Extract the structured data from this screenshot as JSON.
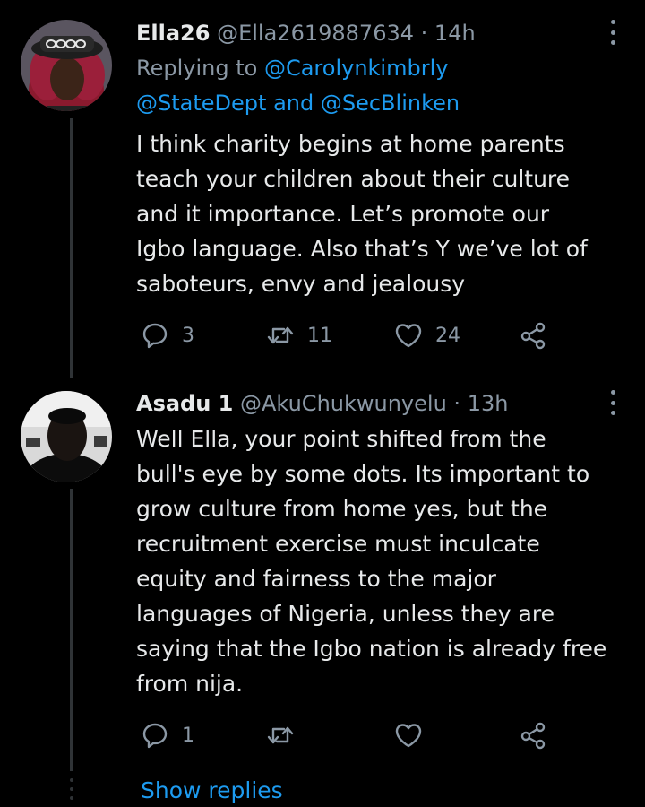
{
  "tweets": [
    {
      "name": "Ella26",
      "handle": "@Ella2619887634",
      "time": "14h",
      "replying_prefix": "Replying to",
      "mentions_line1": "@Carolynkimbrly",
      "mentions_line2_a": "@StateDept",
      "mentions_and": "and",
      "mentions_line2_b": "@SecBlinken",
      "text_lines": [
        "I think charity begins at home parents",
        "teach your children about their culture",
        "and it importance. Let’s promote our",
        "Igbo language. Also that’s Y we’ve lot of",
        "saboteurs, envy and jealousy"
      ],
      "replies": "3",
      "retweets": "11",
      "likes": "24"
    },
    {
      "name": "Asadu 1",
      "handle": "@AkuChukwunyelu",
      "time": "13h",
      "text_lines": [
        "Well Ella, your point shifted from the",
        "bull's eye by some dots. Its important to",
        "grow culture from home yes, but the",
        "recruitment exercise must inculcate",
        "equity and fairness to the major",
        "languages of Nigeria, unless they are",
        "saying that the Igbo nation is already free",
        "from nija."
      ],
      "replies": "1"
    }
  ],
  "show_replies_label": "Show replies",
  "icons": [
    "reply-icon",
    "retweet-icon",
    "like-icon",
    "share-icon",
    "more-icon"
  ],
  "colors": {
    "background": "#000000",
    "link": "#1d9bf0",
    "muted": "#8b98a5",
    "text": "#e7e9ea"
  }
}
